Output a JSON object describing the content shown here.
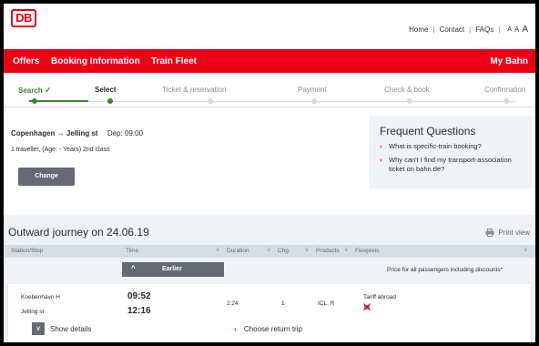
{
  "header": {
    "logo_text": "DB",
    "links": [
      "Home",
      "Contact",
      "FAQs"
    ],
    "font_size_controls": [
      "A",
      "A",
      "A"
    ]
  },
  "nav": {
    "items": [
      "Offers",
      "Booking Information",
      "Train Fleet"
    ],
    "account": "My Bahn"
  },
  "steps": [
    {
      "label": "Search",
      "state": "done",
      "icon": "check-icon"
    },
    {
      "label": "Select",
      "state": "active"
    },
    {
      "label": "Ticket & reservation",
      "state": "pending"
    },
    {
      "label": "Payment",
      "state": "pending"
    },
    {
      "label": "Check & book",
      "state": "pending"
    },
    {
      "label": "Confirmation",
      "state": "pending"
    }
  ],
  "summary": {
    "from": "Copenhagen",
    "arrow": "→",
    "to": "Jelling st",
    "departure": "Dep: 09:00",
    "travellers": "1 traveller, (Age: - Years) 2nd class",
    "change_label": "Change"
  },
  "faq": {
    "title": "Frequent Questions",
    "links": [
      "What is specific-train booking?",
      "Why can't I find my transport-association ticket on bahn.de?"
    ]
  },
  "outward": {
    "title": "Outward journey on 24.06.19",
    "print_label": "Print view",
    "columns": [
      "Station/Stop",
      "Time",
      "Duration",
      "Chg.",
      "Products",
      "Flexpreis"
    ],
    "earlier_label": "Earlier",
    "price_note": "Price for all passengers including discounts*",
    "connection": {
      "from": "Koebenhavn H",
      "to": "Jelling st",
      "dep_time": "09:52",
      "arr_time": "12:16",
      "duration": "2:24",
      "changes": "1",
      "products": "ICL, R",
      "tariff": "Tariff abroad",
      "show_details_label": "Show details",
      "return_trip_label": "Choose return trip"
    }
  },
  "colors": {
    "brand_red": "#ec0016",
    "progress_green": "#408335",
    "button_grey": "#646973",
    "panel_grey": "#f0f3f5"
  }
}
